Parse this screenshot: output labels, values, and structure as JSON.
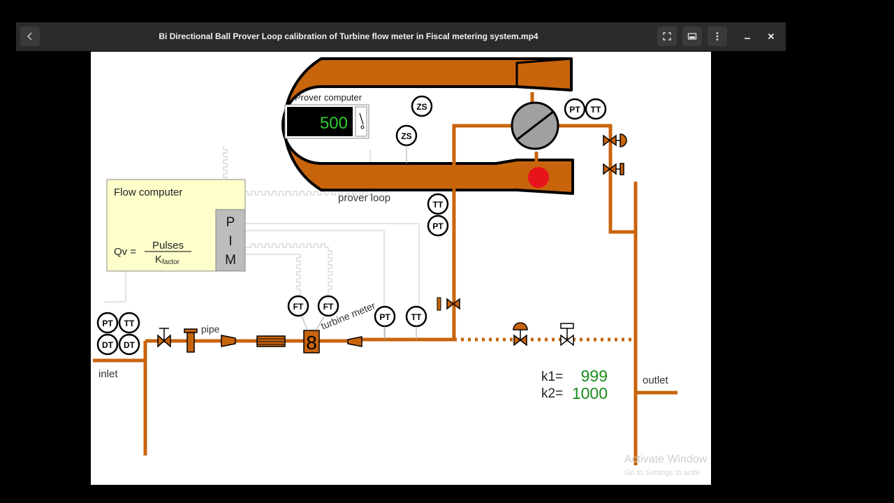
{
  "window": {
    "title": "Bi Directional Ball Prover Loop calibration of Turbine flow meter in Fiscal metering system.mp4"
  },
  "icons": {
    "back": "chevron-left-icon",
    "fullscreen": "fullscreen-icon",
    "miniplayer": "miniplayer-icon",
    "menu": "more-vertical-icon",
    "minimize": "minimize-icon",
    "close": "close-icon"
  },
  "diagram": {
    "prover_computer_label": "Prover computer",
    "prover_display_value": "500",
    "flow_computer_label": "Flow computer",
    "formula_qv": "Qv =",
    "formula_numerator": "Pulses",
    "formula_denominator_k": "K",
    "formula_denominator_sub": "factor",
    "pim_letters": [
      "P",
      "I",
      "M"
    ],
    "prover_loop_label": "prover loop",
    "pipe_label": "pipe",
    "turbine_meter_label": "turbine meter",
    "inlet_label": "inlet",
    "outlet_label": "outlet",
    "k1_label": "k1=",
    "k1_value": "999",
    "k2_label": "k2=",
    "k2_value": "1000",
    "meter_digit": "8",
    "instruments": {
      "zs": "ZS",
      "pt": "PT",
      "tt": "TT",
      "ft": "FT",
      "dt": "DT"
    },
    "watermark_line1": "Activate Window",
    "watermark_line2": "Go to Settings to activ"
  },
  "colors": {
    "pipe": "#c8640c",
    "pipe_dark": "#000000",
    "ball": "#e8141c",
    "display_text": "#2ecc2e",
    "k_value": "#1a8c1a",
    "flow_computer_bg": "#ffffcc"
  }
}
